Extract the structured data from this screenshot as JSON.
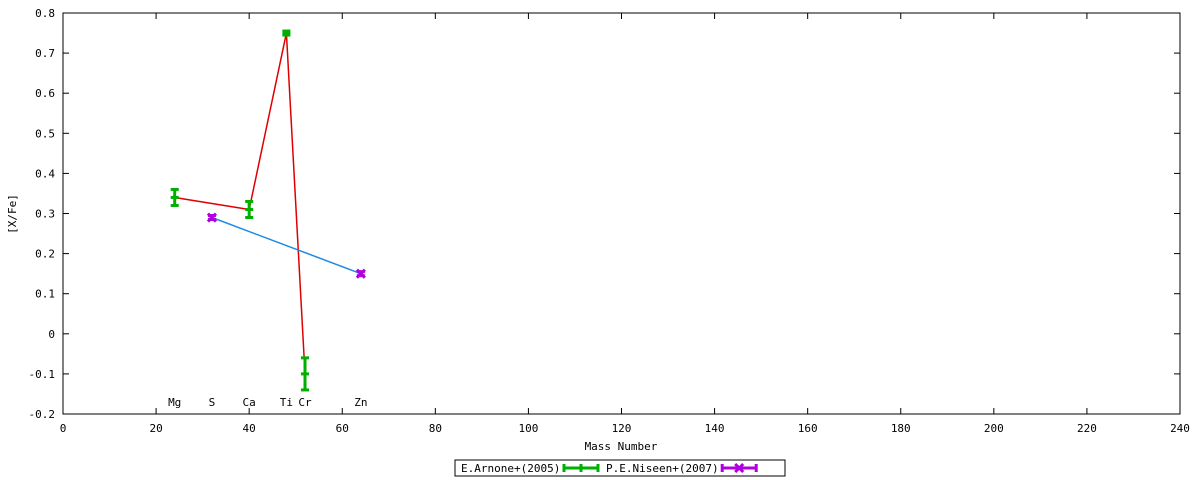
{
  "chart_data": {
    "type": "scatter",
    "title": "",
    "xlabel": "Mass Number",
    "ylabel": "[X/Fe]",
    "xlim": [
      0,
      240
    ],
    "ylim": [
      -0.2,
      0.8
    ],
    "x_ticks": [
      "0",
      "20",
      "40",
      "60",
      "80",
      "100",
      "120",
      "140",
      "160",
      "180",
      "200",
      "220",
      "240"
    ],
    "y_ticks": [
      "0.8",
      "0.7",
      "0.6",
      "0.5",
      "0.4",
      "0.3",
      "0.2",
      "0.1",
      "0",
      "-0.1",
      "-0.2"
    ],
    "grid": false,
    "legend_position": "bottom-center",
    "element_labels": [
      {
        "text": "Mg",
        "x": 24
      },
      {
        "text": "S",
        "x": 32
      },
      {
        "text": "Ca",
        "x": 40
      },
      {
        "text": "Ti",
        "x": 48
      },
      {
        "text": "Cr",
        "x": 52
      },
      {
        "text": "Zn",
        "x": 64
      }
    ],
    "series": [
      {
        "name": "E.Arnone+(2005)",
        "marker_color": "#00b000",
        "line_color": "#e00000",
        "points": [
          {
            "x": 24,
            "y": 0.34,
            "err": 0.02
          },
          {
            "x": 40,
            "y": 0.31,
            "err": 0.02
          },
          {
            "x": 48,
            "y": 0.75,
            "err": 0.005
          },
          {
            "x": 52,
            "y": -0.1,
            "err": 0.04
          }
        ]
      },
      {
        "name": "P.E.Niseen+(2007)",
        "marker_color": "#b000e0",
        "line_color": "#1e88e5",
        "points": [
          {
            "x": 32,
            "y": 0.29,
            "err": 0.005
          },
          {
            "x": 64,
            "y": 0.15,
            "err": 0.005
          }
        ]
      }
    ]
  }
}
